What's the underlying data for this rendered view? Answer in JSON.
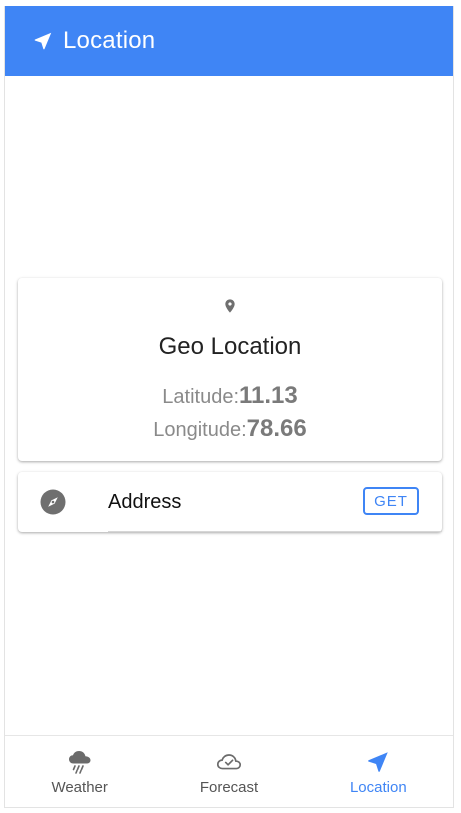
{
  "appbar": {
    "title": "Location",
    "icon": "navigation-arrow-icon",
    "color": "#3f85f5"
  },
  "geo_card": {
    "icon": "map-pin-icon",
    "heading": "Geo Location",
    "latitude_label": "Latitude:",
    "latitude_value": "11.13",
    "longitude_label": "Longitude:",
    "longitude_value": "78.66"
  },
  "address_card": {
    "icon": "compass-icon",
    "label": "Address",
    "button_label": "GET"
  },
  "bottom_nav": {
    "items": [
      {
        "label": "Weather",
        "icon": "rain-cloud-icon",
        "active": false
      },
      {
        "label": "Forecast",
        "icon": "cloud-check-icon",
        "active": false
      },
      {
        "label": "Location",
        "icon": "navigation-arrow-icon",
        "active": true
      }
    ],
    "active_color": "#3f85f5",
    "inactive_color": "#555555"
  }
}
